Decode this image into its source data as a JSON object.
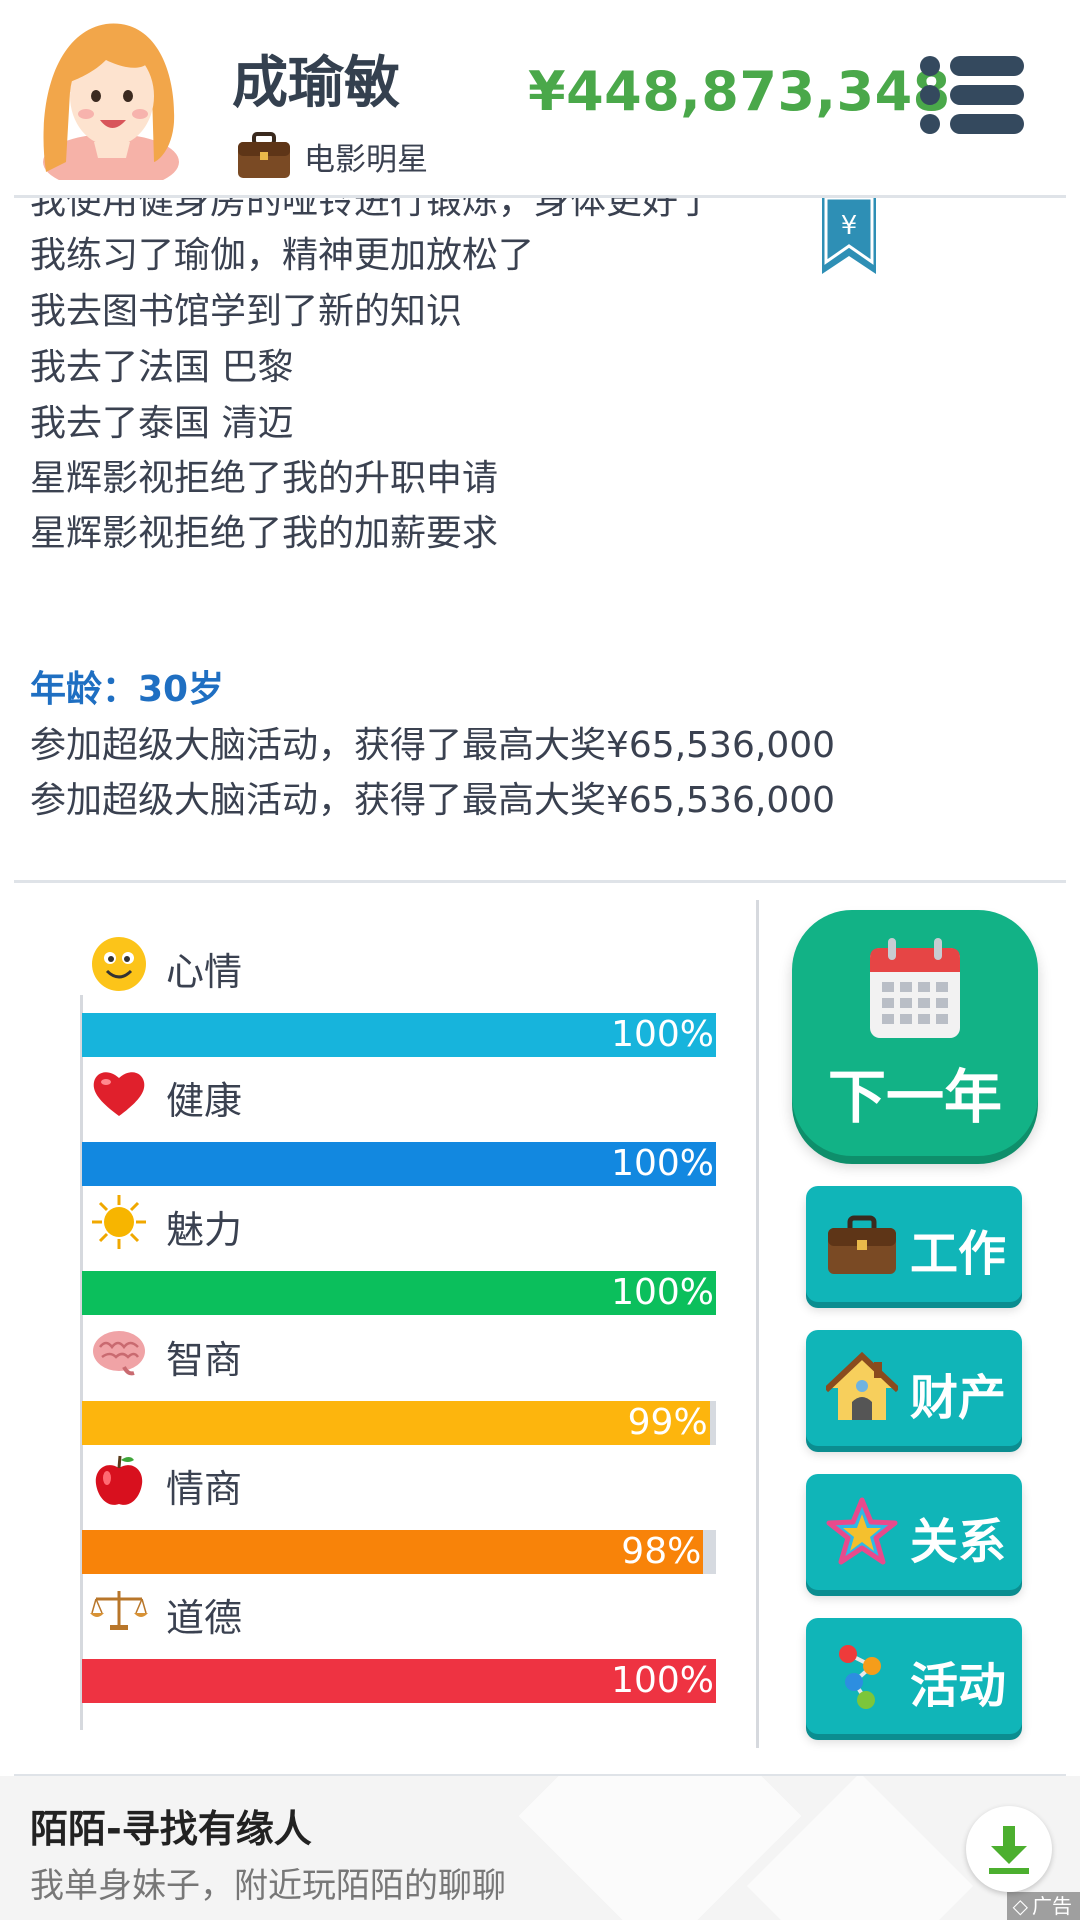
{
  "header": {
    "player_name": "成瑜敏",
    "job_title": "电影明星",
    "money": "¥448,873,348",
    "avatar_icon": "girl-avatar-icon",
    "job_icon": "briefcase-icon",
    "menu_icon": "menu-icon"
  },
  "log": {
    "lines_before_age": [
      "我使用健身房的哑铃进行锻炼，身体更好了",
      "我练习了瑜伽，精神更加放松了",
      "我去图书馆学到了新的知识",
      "我去了法国 巴黎",
      "我去了泰国 清迈",
      "星辉影视拒绝了我的升职申请",
      "星辉影视拒绝了我的加薪要求"
    ],
    "age_label": "年龄：30岁",
    "lines_after_age": [
      "参加超级大脑活动，获得了最高大奖¥65,536,000",
      "参加超级大脑活动，获得了最高大奖¥65,536,000"
    ],
    "bookmark_icon": "yen-bookmark-icon",
    "bookmark_glyph": "¥"
  },
  "stats": [
    {
      "label": "心情",
      "percent_text": "100%",
      "value": 1.0,
      "color": "#17b4dc",
      "icon": "smiley-icon"
    },
    {
      "label": "健康",
      "percent_text": "100%",
      "value": 1.0,
      "color": "#1288e0",
      "icon": "heart-icon"
    },
    {
      "label": "魅力",
      "percent_text": "100%",
      "value": 1.0,
      "color": "#0bbf5c",
      "icon": "sun-icon"
    },
    {
      "label": "智商",
      "percent_text": "99%",
      "value": 0.99,
      "color": "#fdb50d",
      "icon": "brain-icon"
    },
    {
      "label": "情商",
      "percent_text": "98%",
      "value": 0.98,
      "color": "#f88309",
      "icon": "apple-icon"
    },
    {
      "label": "道德",
      "percent_text": "100%",
      "value": 1.0,
      "color": "#ee3342",
      "icon": "scales-icon"
    }
  ],
  "buttons": {
    "next_year": "下一年",
    "work": "工作",
    "property": "财产",
    "relations": "关系",
    "activities": "活动"
  },
  "ad": {
    "title": "陌陌-寻找有缘人",
    "desc": "我单身妹子，附近玩陌陌的聊聊",
    "badge": "广告",
    "download_icon": "download-icon"
  },
  "colors": {
    "money": "#4aa84a",
    "age": "#1f6fc2",
    "next_year_button": "#12b286",
    "side_button": "#10b5b8"
  }
}
